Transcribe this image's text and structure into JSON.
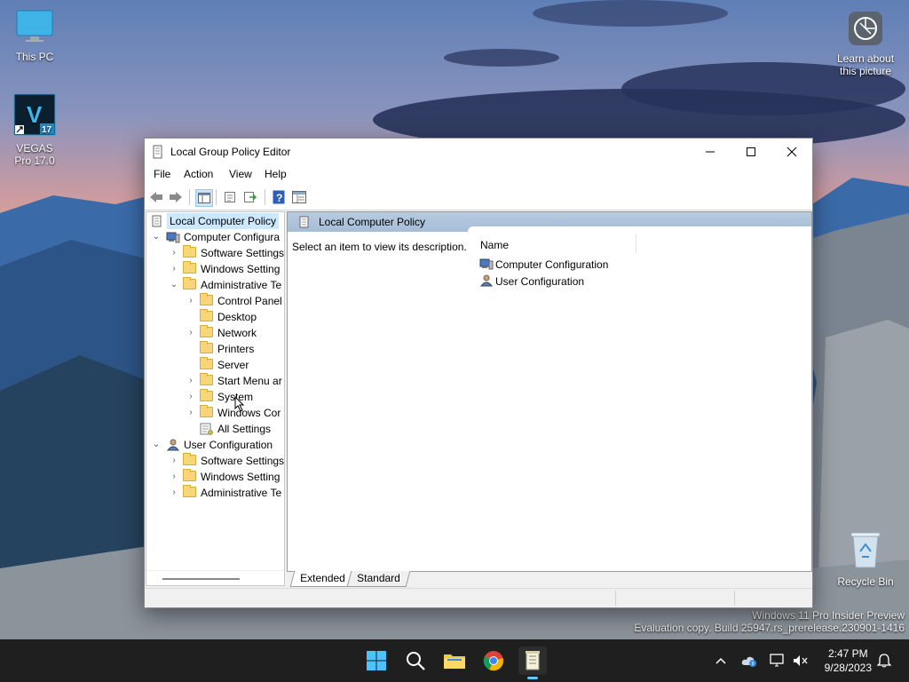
{
  "desktop": {
    "icons": [
      {
        "label": "This PC"
      },
      {
        "label": "VEGAS Pro 17.0",
        "badge": "17"
      },
      {
        "label": "Learn about this picture"
      },
      {
        "label": "Recycle Bin"
      }
    ],
    "watermark": {
      "line1": "Windows 11 Pro Insider Preview",
      "line2": "Evaluation copy. Build 25947.rs_prerelease.230901-1416"
    }
  },
  "window": {
    "title": "Local Group Policy Editor",
    "menu": [
      "File",
      "Action",
      "View",
      "Help"
    ],
    "toolbar_icons": [
      "back-arrow-icon",
      "forward-arrow-icon",
      "show-hide-tree-icon",
      "properties-icon",
      "export-list-icon",
      "help-icon",
      "extended-view-icon"
    ],
    "tree": {
      "items": [
        {
          "label": "Local Computer Policy",
          "selected": true
        },
        {
          "label": "Computer Configura"
        },
        {
          "label": "Software Settings"
        },
        {
          "label": "Windows Setting"
        },
        {
          "label": "Administrative Te"
        },
        {
          "label": "Control Panel"
        },
        {
          "label": "Desktop"
        },
        {
          "label": "Network"
        },
        {
          "label": "Printers"
        },
        {
          "label": "Server"
        },
        {
          "label": "Start Menu ar"
        },
        {
          "label": "System"
        },
        {
          "label": "Windows Cor"
        },
        {
          "label": "All Settings"
        },
        {
          "label": "User Configuration"
        },
        {
          "label": "Software Settings"
        },
        {
          "label": "Windows Setting"
        },
        {
          "label": "Administrative Te"
        }
      ]
    },
    "right": {
      "header": "Local Computer Policy",
      "description": "Select an item to view its description.",
      "column_name": "Name",
      "items": [
        {
          "label": "Computer Configuration"
        },
        {
          "label": "User Configuration"
        }
      ]
    },
    "tabs": [
      {
        "label": "Extended",
        "active": true
      },
      {
        "label": "Standard",
        "active": false
      }
    ]
  },
  "taskbar": {
    "time": "2:47 PM",
    "date": "9/28/2023",
    "accent": "#60cdff"
  }
}
